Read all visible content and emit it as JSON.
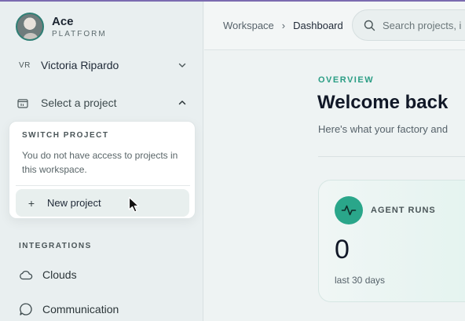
{
  "brand": {
    "name": "Ace",
    "subtitle": "PLATFORM"
  },
  "user": {
    "initials": "VR",
    "name": "Victoria Ripardo"
  },
  "project_selector": {
    "label": "Select a project"
  },
  "dropdown": {
    "title": "SWITCH PROJECT",
    "message": "You do not have access to projects in this workspace.",
    "new_project_label": "New project"
  },
  "integrations": {
    "title": "INTEGRATIONS",
    "items": [
      {
        "label": "Clouds",
        "icon": "cloud-icon"
      },
      {
        "label": "Communication",
        "icon": "chat-bubble-icon"
      }
    ]
  },
  "breadcrumb": {
    "items": [
      "Workspace",
      "Dashboard"
    ]
  },
  "search": {
    "placeholder": "Search projects, i"
  },
  "main": {
    "section_label": "OVERVIEW",
    "heading": "Welcome back",
    "subheading": "Here's what your factory and"
  },
  "stat_card": {
    "title": "AGENT RUNS",
    "value": "0",
    "caption": "last 30 days",
    "icon": "activity-pulse-icon"
  },
  "colors": {
    "accent": "#2aa68a",
    "sidebar_bg": "#e9eff0",
    "main_bg": "#eef3f3"
  }
}
